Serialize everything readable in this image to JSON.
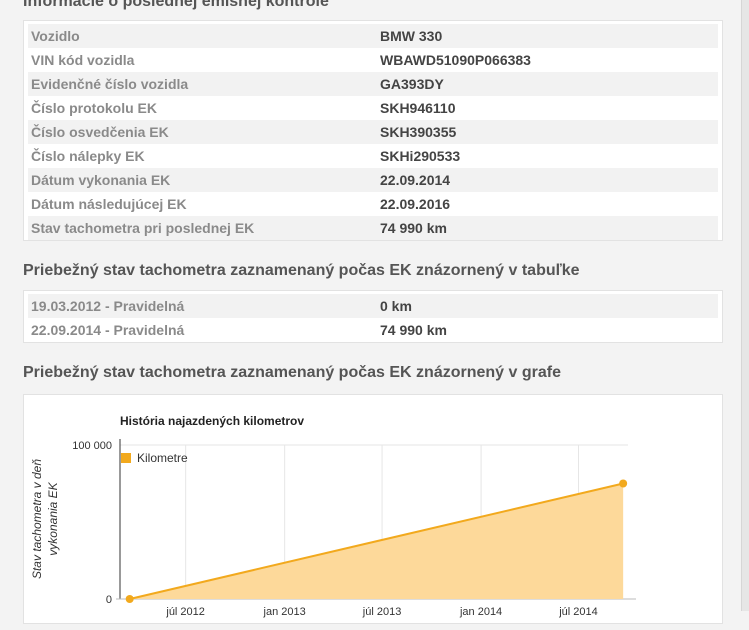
{
  "emission_section": {
    "title": "Informácie o poslednej emisnej kontrole",
    "rows": [
      {
        "label": "Vozidlo",
        "value": "BMW 330"
      },
      {
        "label": "VIN kód vozidla",
        "value": "WBAWD51090P066383"
      },
      {
        "label": "Evidenčné číslo vozidla",
        "value": "GA393DY"
      },
      {
        "label": "Číslo protokolu EK",
        "value": "SKH946110"
      },
      {
        "label": "Číslo osvedčenia EK",
        "value": "SKH390355"
      },
      {
        "label": "Číslo nálepky EK",
        "value": "SKHi290533"
      },
      {
        "label": "Dátum vykonania EK",
        "value": "22.09.2014"
      },
      {
        "label": "Dátum následujúcej EK",
        "value": "22.09.2016"
      },
      {
        "label": "Stav tachometra pri poslednej EK",
        "value": "74 990 km"
      }
    ]
  },
  "table_section": {
    "title": "Priebežný stav tachometra zaznamenaný počas EK znázornený v tabuľke",
    "rows": [
      {
        "label": "19.03.2012 - Pravidelná",
        "value": "0 km"
      },
      {
        "label": "22.09.2014 - Pravidelná",
        "value": "74 990 km"
      }
    ]
  },
  "chart_section": {
    "title": "Priebežný stav tachometra zaznamenaný počas EK znázornený v grafe"
  },
  "chart_data": {
    "type": "area",
    "title": "História najazdených kilometrov",
    "ylabel_line1": "Stav tachometra v deň",
    "ylabel_line2": "vykonania EK",
    "ylim": [
      0,
      100000
    ],
    "y_ticks": [
      "0",
      "100 000"
    ],
    "x_tick_labels": [
      "júl 2012",
      "jan 2013",
      "júl 2013",
      "jan 2014",
      "júl 2014"
    ],
    "series": [
      {
        "name": "Kilometre",
        "x": [
          "2012-03-19",
          "2014-09-22"
        ],
        "y": [
          0,
          74990
        ],
        "color": "#f2a91d",
        "fill": "#fdd99a"
      }
    ],
    "legend_position": "top-left",
    "grid": true
  }
}
